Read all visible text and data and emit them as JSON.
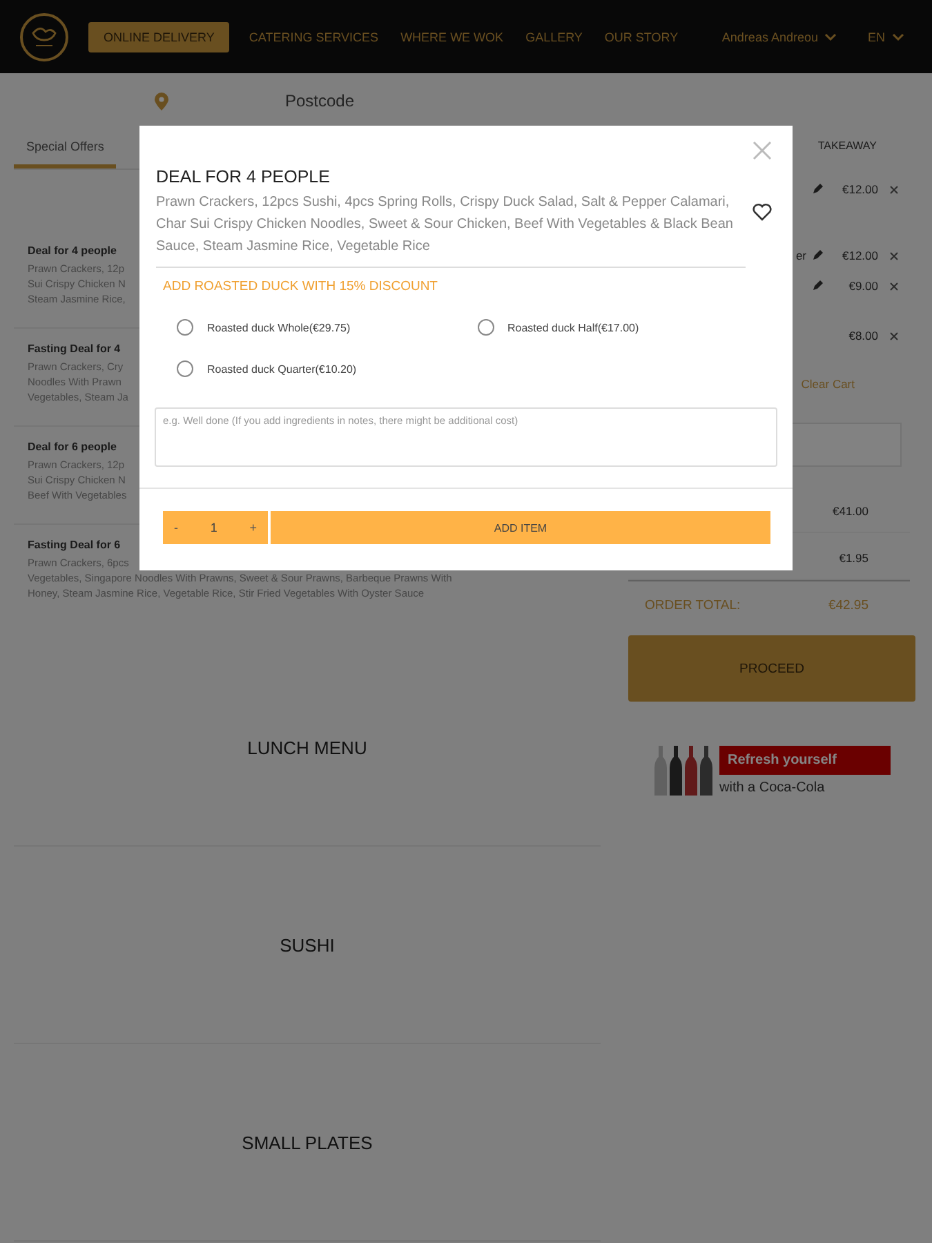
{
  "header": {
    "nav": [
      {
        "label": "ONLINE DELIVERY",
        "selected": true
      },
      {
        "label": "CATERING SERVICES",
        "selected": false
      },
      {
        "label": "WHERE WE WOK",
        "selected": false
      },
      {
        "label": "GALLERY",
        "selected": false
      },
      {
        "label": "OUR STORY",
        "selected": false
      }
    ],
    "user": "Andreas Andreou",
    "language": "EN"
  },
  "postcode": {
    "placeholder": "Postcode"
  },
  "tabs": [
    {
      "label": "Special Offers",
      "selected": true
    }
  ],
  "menu_items": [
    {
      "title": "Deal for 4 people",
      "lines": [
        "Prawn Crackers, 12p",
        "Sui Crispy Chicken N",
        "Steam Jasmine Rice,"
      ]
    },
    {
      "title": "Fasting Deal for 4",
      "lines": [
        "Prawn Crackers, Cry",
        "Noodles With Prawn",
        "Vegetables, Steam Ja"
      ]
    },
    {
      "title": "Deal for 6 people",
      "lines": [
        "Prawn Crackers, 12p",
        "Sui Crispy Chicken N",
        "Beef With Vegetables"
      ]
    },
    {
      "title": "Fasting Deal for 6",
      "lines": [
        "Prawn Crackers, 6pcs",
        "Vegetables, Singapore Noodles With Prawns, Sweet & Sour Prawns, Barbeque Prawns With",
        "Honey, Steam Jasmine Rice, Vegetable Rice, Stir Fried Vegetables With Oyster Sauce"
      ]
    }
  ],
  "sections": [
    "LUNCH MENU",
    "SUSHI",
    "SMALL PLATES"
  ],
  "cart": {
    "mode": "TAKEAWAY",
    "items": [
      {
        "editable": true,
        "price": "€12.00"
      },
      {
        "name": "er",
        "editable": true,
        "price": "€12.00"
      },
      {
        "editable": true,
        "price": "€9.00"
      },
      {
        "editable": false,
        "price": "€8.00"
      }
    ],
    "clear": "Clear Cart",
    "subtotal": "€41.00",
    "fee": "€1.95",
    "total_label": "ORDER TOTAL:",
    "total": "€42.95",
    "proceed": "PROCEED",
    "ad": {
      "headline": "Refresh yourself",
      "tagline": "with a Coca-Cola"
    }
  },
  "dialog": {
    "title": "DEAL FOR 4 PEOPLE",
    "description": "Prawn Crackers, 12pcs Sushi, 4pcs Spring Rolls, Crispy Duck Salad, Salt & Pepper Calamari, Char Sui Crispy Chicken Noodles, Sweet & Sour Chicken, Beef With Vegetables & Black Bean Sauce, Steam Jasmine Rice, Vegetable Rice",
    "favorite": false,
    "option_heading": "ADD ROASTED DUCK WITH 15% DISCOUNT",
    "options": [
      {
        "label": "Roasted duck Whole(€29.75)",
        "checked": false
      },
      {
        "label": "Roasted duck Half(€17.00)",
        "checked": false
      },
      {
        "label": "Roasted duck Quarter(€10.20)",
        "checked": false
      }
    ],
    "notes": {
      "placeholder": "e.g. Well done (If you add ingredients in notes, there might be additional cost)"
    },
    "quantity": {
      "minus": "-",
      "value": "1",
      "plus": "+"
    },
    "add_button": "ADD ITEM"
  }
}
